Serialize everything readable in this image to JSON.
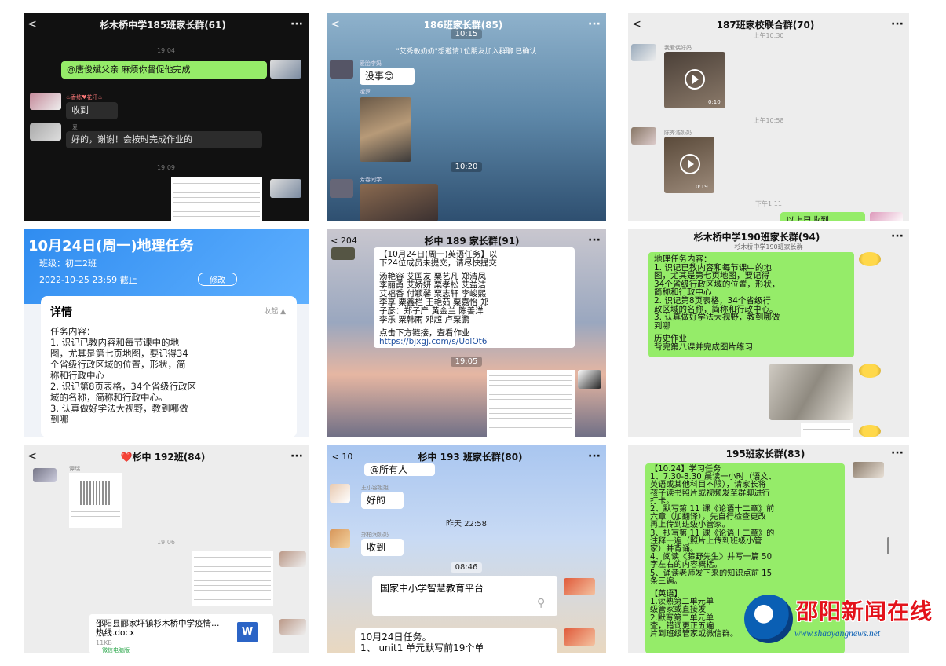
{
  "p1": {
    "title": "杉木桥中学185班家长群(61)",
    "back": "<",
    "more": "···",
    "ts1": "19:04",
    "msg1": "@唐俊斌父亲  麻烦你督促他完成",
    "name2": "♨香练♥花汗♨",
    "msg2": "收到",
    "name3": "爱",
    "msg3": "好的，谢谢！会按时完成作业的",
    "ts2": "19:09"
  },
  "p2": {
    "title": "186班家长群(85)",
    "back": "<",
    "more": "···",
    "ts1": "10:15",
    "sys": "\"艾秀敏奶奶\"想邀请1位朋友加入群聊  已确认",
    "name1": "爱胎李妈",
    "msg1": "没事😊",
    "name2": "嗳罗",
    "ts2": "10:20",
    "name3": "芳春同学"
  },
  "p3": {
    "title": "187班家校联合群(70)",
    "back": "<",
    "more": "···",
    "ts1": "上午10:30",
    "name1": "我爱偶好妈",
    "dur1": "0:10",
    "ts2": "上午10:58",
    "name2": "陈秀浩奶奶",
    "dur2": "0:19",
    "ts3": "下午1:11",
    "msg": "以上已收到"
  },
  "p4": {
    "title": "10月24日(周一)地理任务",
    "class": "班级：初二2班",
    "deadline": "2022-10-25 23:59 截止",
    "edit": "修改",
    "detail": "详情",
    "collapse": "收起 ▲",
    "content": [
      "任务内容：",
      "1. 识记已教内容和每节课中的地",
      "图，尤其是第七页地图，要记得34",
      "个省级行政区域的位置，形状，简",
      "称和行政中心",
      "2. 识记第8页表格，34个省级行政区",
      "域的名称，简称和行政中心。",
      "3. 认真做好学法大视野，教到哪做",
      "到哪"
    ]
  },
  "p5": {
    "title": "杉中 189 家长群(91)",
    "back": "< 204",
    "more": "···",
    "msg": [
      "【10月24日(周一)英语任务】以",
      "下24位成员未提交，请尽快提交",
      "",
      "汤艳容  艾国友  粟艺凡  郑清凤",
      "李丽勇  艾娇妍  粟孝松  艾益洁",
      "艾福香  付颖馨  粟志轩  李峻熙",
      "李享  粟鑫栏  王艳茹  粟嘉怡  郑",
      "子彦：郑子产  黄金兰  陈善洋",
      "李乐  粟韩雨  邓超  卢粟鹏",
      "",
      "点击下方链接，查看作业",
      "https://bjxgj.com/s/UolOt6"
    ],
    "ts": "19:05"
  },
  "p6": {
    "title": "杉木桥中学190班家长群(94)",
    "sub": "杉木桥中学190班家长群",
    "more": "···",
    "msg": [
      "地理任务内容：",
      "1. 识记已教内容和每节课中的地",
      "图，尤其是第七页地图，要记得",
      "34个省级行政区域的位置，形状，",
      "简称和行政中心",
      "2. 识记第8页表格，34个省级行",
      "政区域的名称，简称和行政中心。",
      "3. 认真做好学法大视野，教到哪做",
      "到哪",
      "",
      "历史作业",
      "背完第八课并完成图片练习"
    ]
  },
  "p7": {
    "title": "❤️杉中 192班(84)",
    "back": "<",
    "more": "···",
    "name1": "谭瑞",
    "ts": "19:06",
    "file": "邵阳县郦家坪镇杉木桥中学疫情…热线.docx",
    "size": "11KB",
    "app": "微信电脑版",
    "w": "W"
  },
  "p8": {
    "title": "杉中 193 班家长群(80)",
    "back": "< 10",
    "more": "···",
    "msg0": "@所有人",
    "name1": "王小容姐姐",
    "msg1": "好的",
    "ts1": "昨天 22:58",
    "name2": "郑柏润奶奶",
    "msg2": "收到",
    "ts2": "08:46",
    "card": "国家中小学智慧教育平台",
    "msg3a": "10月24日任务。",
    "msg3b": "1、 unit1 单元默写前19个单"
  },
  "p9": {
    "title": "195班家长群(83)",
    "more": "···",
    "msg": [
      "【10.24】学习任务",
      "1、7.30-8.30 晨读一小时（语文、",
      "英语或其他科目不限），请家长将",
      "孩子读书照片或视频发至群聊进行",
      "打卡。",
      "2、默写第 11 课《论语十二章》前",
      "六章（加翻译），先自行检查更改",
      "再上传到班级小管家。",
      "3、抄写第 11 课《论语十二章》的",
      "注释一遍（照片上传到班级小管",
      "家）并背诵。",
      "4、阅读《藤野先生》并写一篇 50",
      "字左右的内容概括。",
      "5、诵读老师发下来的知识点前 15",
      "条三遍。",
      "",
      "【英语】",
      "1.读熟第二单元单",
      "级管家或直接发",
      "2.默写第二单元单",
      "查，错词更正五遍",
      "片到班级管家或微信群。"
    ]
  },
  "logo": {
    "name": "邵阳新闻在线",
    "url": "www.shaoyangnews.net"
  },
  "colors": {
    "wechat_green": "#95ec69",
    "task_blue": "#2f8cf0",
    "logo_red": "#e3121a",
    "logo_blue": "#0a5fb4"
  }
}
